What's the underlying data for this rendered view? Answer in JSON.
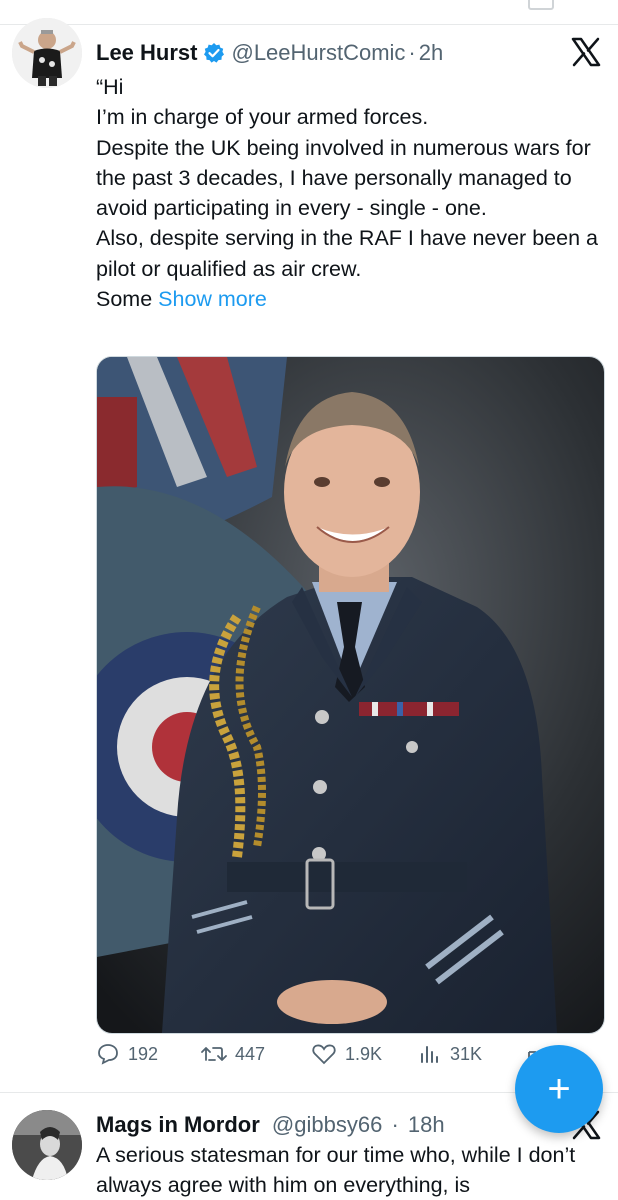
{
  "tweet1": {
    "author_name": "Lee Hurst",
    "handle": "@LeeHurstComic",
    "separator": "·",
    "time": "2h",
    "body_lines": [
      "“Hi",
      "I’m in charge of your armed forces.",
      "Despite the UK being involved in numerous wars for the past 3 decades, I have personally managed to avoid participating in every - single - one.",
      "Also, despite serving in the RAF I have never been a pilot or qualified as air crew."
    ],
    "truncated_text": "Some ",
    "show_more": "Show more",
    "stats": {
      "replies": "192",
      "reposts": "447",
      "likes": "1.9K",
      "views": "31K"
    }
  },
  "tweet2": {
    "author_name": "Mags in Mordor",
    "handle": "@gibbsy66",
    "separator": "·",
    "time": "18h",
    "body": "A serious statesman for our time who, while I don’t always agree with him on everything, is"
  },
  "compose_fab": {
    "label": "+"
  },
  "colors": {
    "accent": "#1d9bf0",
    "muted": "#536471",
    "text": "#0f1419"
  },
  "icons": [
    "x-logo-icon",
    "verified-badge-icon",
    "reply-icon",
    "repost-icon",
    "like-icon",
    "views-icon",
    "share-icon",
    "plus-icon"
  ]
}
